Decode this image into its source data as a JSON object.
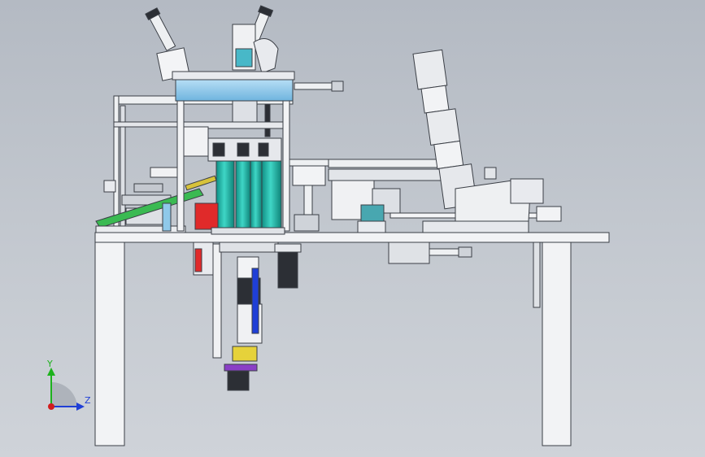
{
  "viewport": {
    "background_top": "#b4bac3",
    "background_bottom": "#cfd3d9"
  },
  "triad": {
    "y_label": "Y",
    "z_label": "Z",
    "y_color": "#1db21d",
    "z_color": "#1f3fd6",
    "x_color": "#d11d1d"
  },
  "colors": {
    "frame_white": "#f4f4f6",
    "frame_grey": "#d6d9de",
    "outline": "#3b3f46",
    "cyan_tube": "#19b5a6",
    "blue_plate": "#8fc9ea",
    "red_block": "#e02a2a",
    "dark_motor": "#2c2f35",
    "green_rail": "#1fa83a",
    "purple_band": "#8a3fc6",
    "yellow_part": "#e6d23a"
  }
}
